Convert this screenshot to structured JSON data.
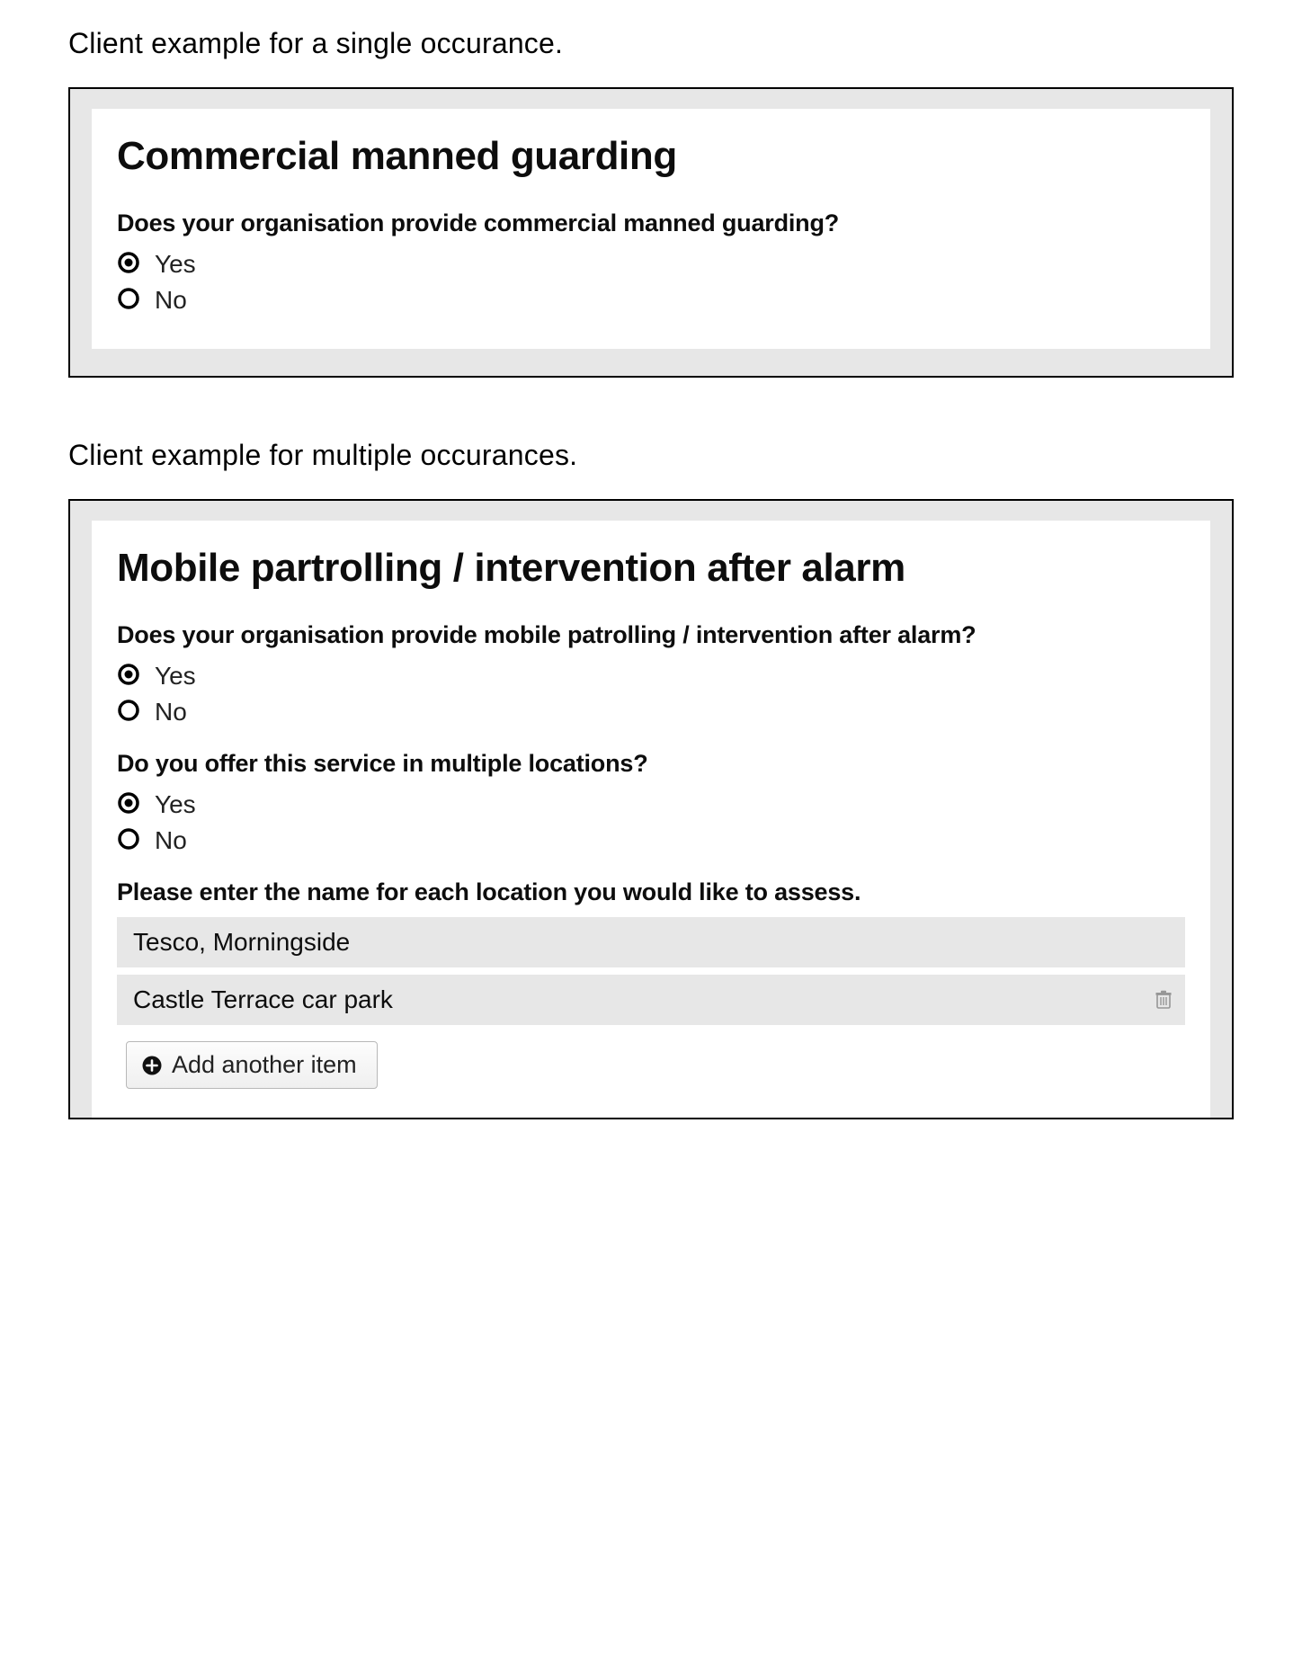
{
  "captions": {
    "single": "Client example for a single occurance.",
    "multiple": "Client example for multiple occurances."
  },
  "panel1": {
    "title": "Commercial manned guarding",
    "q1": {
      "text": "Does your organisation provide commercial manned guarding?",
      "options": {
        "yes": "Yes",
        "no": "No"
      },
      "selected": "yes"
    }
  },
  "panel2": {
    "title": "Mobile partrolling / intervention after alarm",
    "q1": {
      "text": "Does your organisation provide mobile patrolling / intervention after alarm?",
      "options": {
        "yes": "Yes",
        "no": "No"
      },
      "selected": "yes"
    },
    "q2": {
      "text": "Do you offer this service in multiple locations?",
      "options": {
        "yes": "Yes",
        "no": "No"
      },
      "selected": "yes"
    },
    "q3": {
      "text": "Please enter the name for each location you would like to assess.",
      "items": [
        "Tesco, Morningside",
        "Castle Terrace car park"
      ],
      "add_label": "Add another item"
    }
  }
}
